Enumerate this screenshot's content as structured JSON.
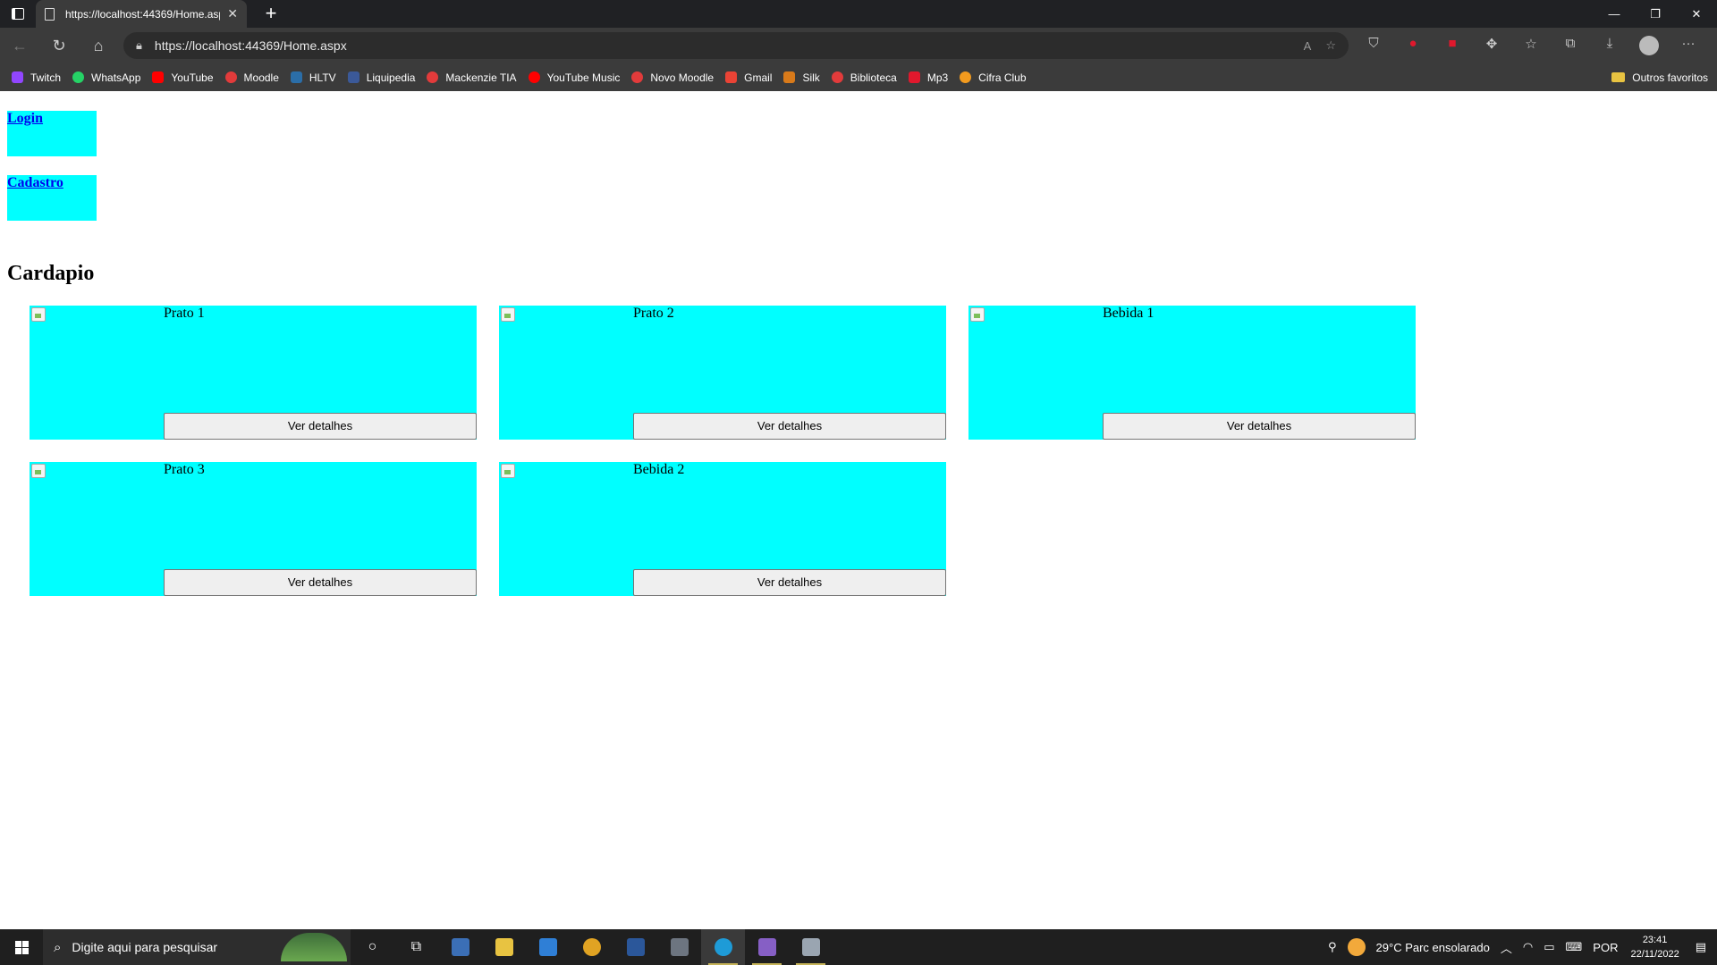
{
  "browser": {
    "tab_title": "https://localhost:44369/Home.aspx",
    "tab_close": "✕",
    "new_tab": "+",
    "url": "https://localhost:44369/Home.aspx",
    "bookmarks": [
      {
        "label": "Twitch",
        "color": "#9146ff"
      },
      {
        "label": "WhatsApp",
        "color": "#25d366"
      },
      {
        "label": "YouTube",
        "color": "#ff0000"
      },
      {
        "label": "Moodle",
        "color": "#e23b3b"
      },
      {
        "label": "HLTV",
        "color": "#2b6ea8"
      },
      {
        "label": "Liquipedia",
        "color": "#3b5998"
      },
      {
        "label": "Mackenzie TIA",
        "color": "#e23b3b"
      },
      {
        "label": "YouTube Music",
        "color": "#ff0000"
      },
      {
        "label": "Novo Moodle",
        "color": "#e23b3b"
      },
      {
        "label": "Gmail",
        "color": "#ea4335"
      },
      {
        "label": "Silk",
        "color": "#d87a1a"
      },
      {
        "label": "Biblioteca",
        "color": "#e23b3b"
      },
      {
        "label": "Mp3",
        "color": "#e0182d"
      },
      {
        "label": "Cifra Club",
        "color": "#f29a1e"
      }
    ],
    "other_favorites": "Outros favoritos"
  },
  "page": {
    "nav_links": [
      "Login",
      "Cadastro"
    ],
    "menu_title": "Cardapio",
    "items": [
      {
        "name": "Prato 1",
        "button": "Ver detalhes"
      },
      {
        "name": "Prato 2",
        "button": "Ver detalhes"
      },
      {
        "name": "Bebida 1",
        "button": "Ver detalhes"
      },
      {
        "name": "Prato 3",
        "button": "Ver detalhes"
      },
      {
        "name": "Bebida 2",
        "button": "Ver detalhes"
      }
    ]
  },
  "taskbar": {
    "search_placeholder": "Digite aqui para pesquisar",
    "weather": "29°C  Parc ensolarado",
    "language": "POR",
    "time": "23:41",
    "date": "22/11/2022"
  },
  "colors": {
    "card_bg": "#00ffff",
    "link": "#0000ee"
  }
}
